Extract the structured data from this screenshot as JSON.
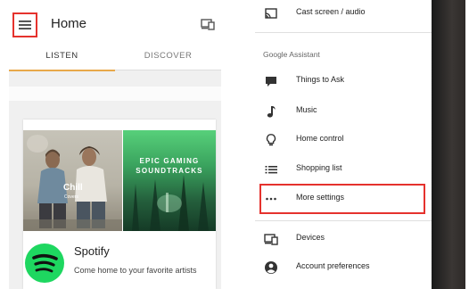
{
  "left_app": {
    "title": "Home",
    "tabs": [
      {
        "label": "LISTEN",
        "selected": true
      },
      {
        "label": "DISCOVER",
        "selected": false
      }
    ],
    "card": {
      "art_chill": {
        "title": "Chill",
        "subtitle": "Covers"
      },
      "art_gaming": {
        "title": "EPIC GAMING\nSOUNDTRACKS"
      },
      "provider_name": "Spotify",
      "provider_description": "Come home to your favorite artists"
    }
  },
  "drawer": {
    "top_item": {
      "label": "Cast screen / audio",
      "icon": "cast-icon"
    },
    "section_label": "Google Assistant",
    "assistant_items": [
      {
        "label": "Things to Ask",
        "icon": "chat-icon"
      },
      {
        "label": "Music",
        "icon": "music-note-icon"
      },
      {
        "label": "Home control",
        "icon": "lightbulb-icon"
      },
      {
        "label": "Shopping list",
        "icon": "list-icon"
      },
      {
        "label": "More settings",
        "icon": "more-dots-icon",
        "highlighted": true
      }
    ],
    "bottom_items": [
      {
        "label": "Devices",
        "icon": "devices-icon"
      },
      {
        "label": "Account preferences",
        "icon": "account-icon"
      }
    ]
  },
  "colors": {
    "highlight_border": "#e5322d",
    "tab_indicator": "#e8a84a",
    "spotify_green": "#1ed760"
  }
}
